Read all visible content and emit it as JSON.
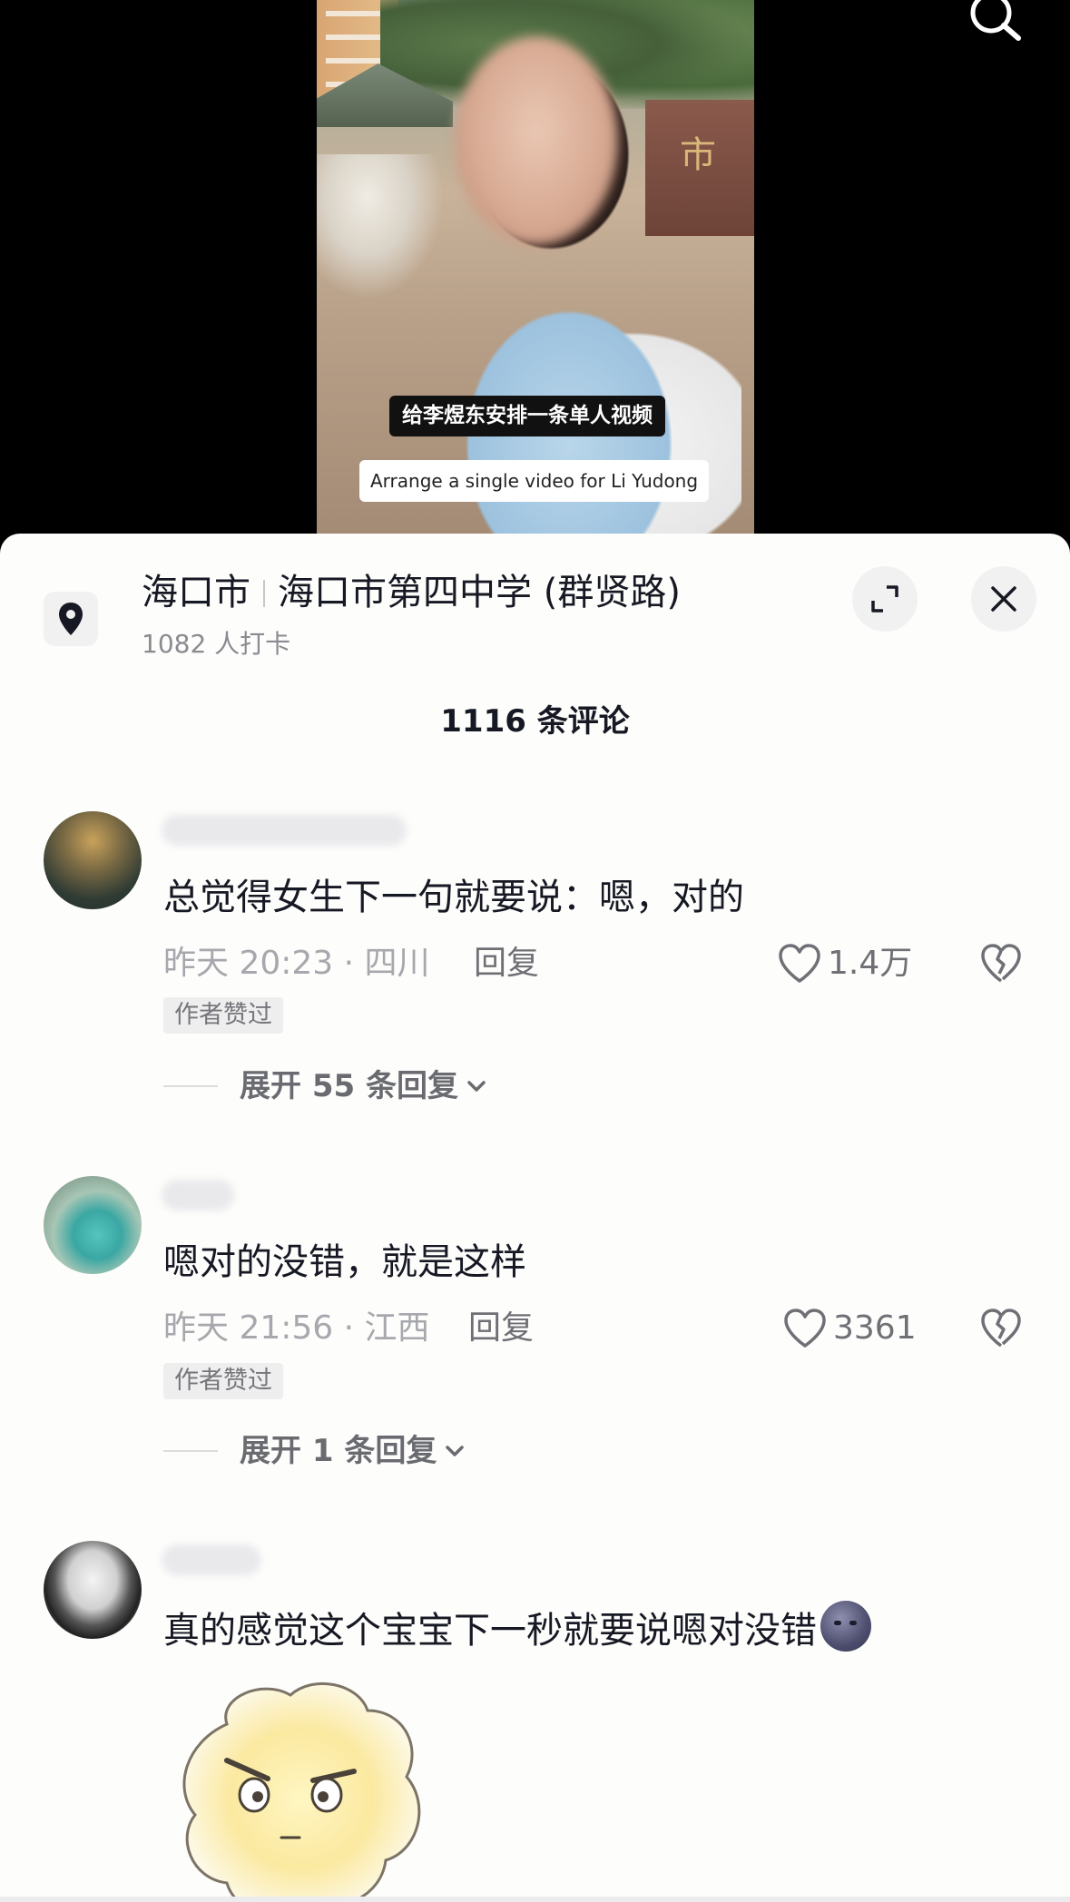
{
  "video": {
    "subtitle_cn": "给李煜东安排一条单人视频",
    "subtitle_en": "Arrange a single video for Li Yudong"
  },
  "location": {
    "city": "海口市",
    "place": "海口市第四中学 (群贤路)",
    "checkins": "1082 人打卡"
  },
  "comments_header": {
    "count_label": "1116 条评论"
  },
  "comments": [
    {
      "text": "总觉得女生下一句就要说：嗯，对的",
      "meta": "昨天 20:23 · 四川",
      "reply": "回复",
      "likes": "1.4万",
      "badge": "作者赞过",
      "expand": "展开 55 条回复"
    },
    {
      "text": "嗯对的没错，就是这样",
      "meta": "昨天 21:56 · 江西",
      "reply": "回复",
      "likes": "3361",
      "badge": "作者赞过",
      "expand": "展开 1 条回复"
    },
    {
      "text": "真的感觉这个宝宝下一秒就要说嗯对没错",
      "emoji": "new-moon-face-emoji"
    }
  ],
  "icons": [
    "search-icon",
    "location-pin-icon",
    "expand-icon",
    "close-icon",
    "heart-icon",
    "dislike-icon",
    "chevron-down-icon"
  ]
}
